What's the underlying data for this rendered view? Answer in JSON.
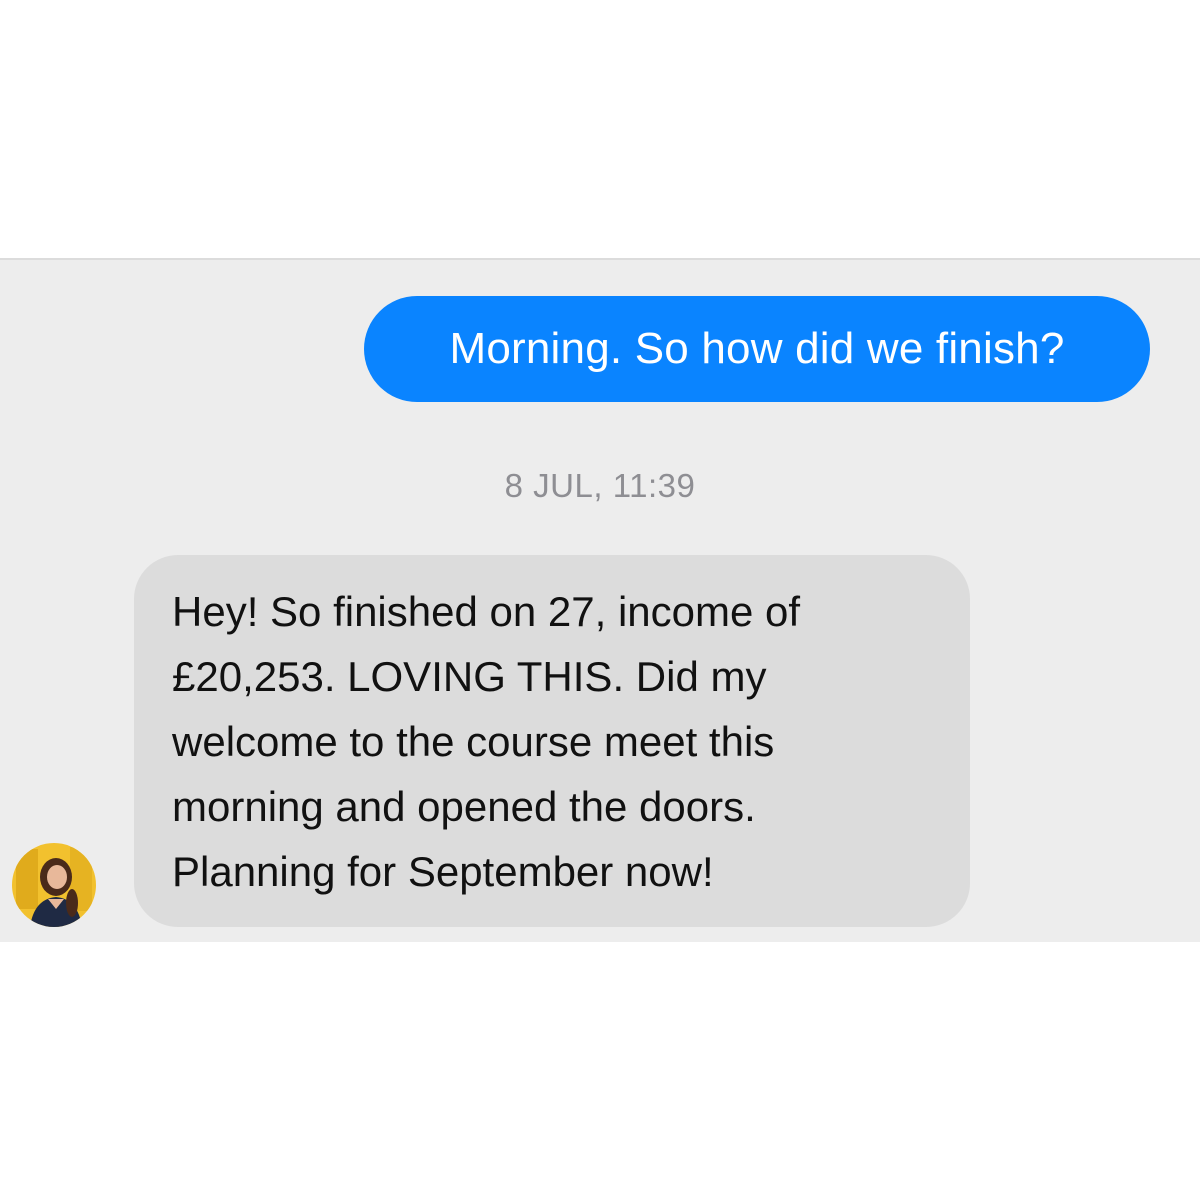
{
  "conversation": {
    "messages": [
      {
        "direction": "outgoing",
        "text": "Morning. So how did we finish?"
      },
      {
        "type": "timestamp",
        "text": "8 JUL, 11:39"
      },
      {
        "direction": "incoming",
        "lines": [
          "Hey! So finished on 27, income of",
          "£20,253. LOVING THIS. Did my",
          "welcome to the course meet this",
          "morning and opened the doors.",
          "Planning for September now!"
        ]
      }
    ]
  },
  "avatar": {
    "icon": "profile-photo-icon"
  },
  "colors": {
    "outgoing_bubble": "#0a84ff",
    "incoming_bubble": "#dcdcdc",
    "chat_background": "#ededed",
    "timestamp_text": "#8e8e93",
    "avatar_background": "#f2c12e"
  }
}
